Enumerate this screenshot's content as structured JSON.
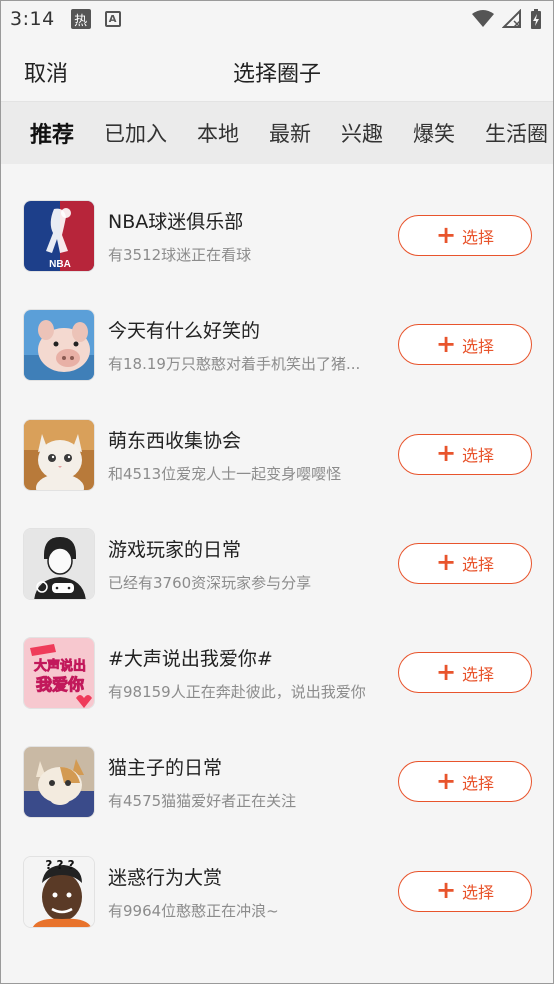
{
  "status_bar": {
    "time": "3:14",
    "badge_text": "热",
    "a_text": "A"
  },
  "header": {
    "cancel_label": "取消",
    "title": "选择圈子"
  },
  "tabs": [
    {
      "label": "推荐"
    },
    {
      "label": "已加入"
    },
    {
      "label": "本地"
    },
    {
      "label": "最新"
    },
    {
      "label": "兴趣"
    },
    {
      "label": "爆笑"
    },
    {
      "label": "生活圈"
    }
  ],
  "items": [
    {
      "name": "NBA球迷俱乐部",
      "desc": "有3512球迷正在看球",
      "button": "选择",
      "avatar_text": "NBA"
    },
    {
      "name": "今天有什么好笑的",
      "desc": "有18.19万只憨憨对着手机笑出了猪...",
      "button": "选择"
    },
    {
      "name": "萌东西收集协会",
      "desc": "和4513位爱宠人士一起变身嘤嘤怪",
      "button": "选择"
    },
    {
      "name": "游戏玩家的日常",
      "desc": "已经有3760资深玩家参与分享",
      "button": "选择"
    },
    {
      "name": "#大声说出我爱你#",
      "desc": "有98159人正在奔赴彼此，说出我爱你",
      "button": "选择",
      "avatar_text_1": "大声说出",
      "avatar_text_2": "我爱你"
    },
    {
      "name": "猫主子的日常",
      "desc": "有4575猫猫爱好者正在关注",
      "button": "选择"
    },
    {
      "name": "迷惑行为大赏",
      "desc": "有9964位憨憨正在冲浪~",
      "button": "选择",
      "avatar_text": "? ? ?"
    }
  ],
  "colors": {
    "accent": "#e8542c",
    "background": "#f5f5f5",
    "tab_bar": "#ebebeb"
  }
}
